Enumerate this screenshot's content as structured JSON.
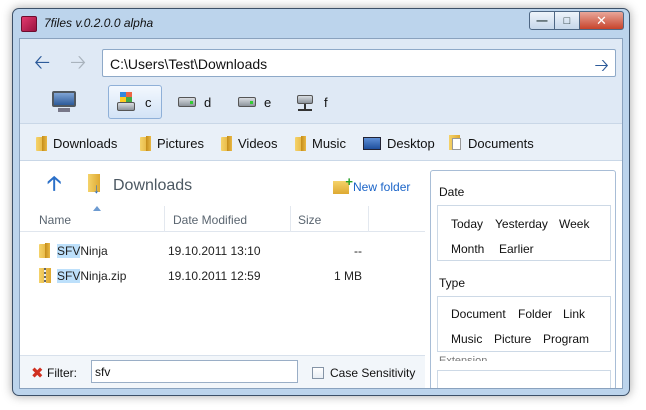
{
  "window": {
    "title": "7files v.0.2.0.0 alpha"
  },
  "address": {
    "path": "C:\\Users\\Test\\Downloads"
  },
  "drives": [
    {
      "label": "c",
      "icon": "windows-drive-icon",
      "selected": true
    },
    {
      "label": "d",
      "icon": "hard-drive-icon"
    },
    {
      "label": "e",
      "icon": "hard-drive-icon"
    },
    {
      "label": "f",
      "icon": "network-drive-icon"
    }
  ],
  "favorites": [
    {
      "label": "Downloads",
      "icon": "folder-icon"
    },
    {
      "label": "Pictures",
      "icon": "folder-icon"
    },
    {
      "label": "Videos",
      "icon": "folder-icon"
    },
    {
      "label": "Music",
      "icon": "folder-icon"
    },
    {
      "label": "Desktop",
      "icon": "desktop-icon"
    },
    {
      "label": "Documents",
      "icon": "documents-icon"
    }
  ],
  "panel": {
    "current_folder": "Downloads",
    "new_folder_label": "New folder",
    "columns": [
      "Name",
      "Date Modified",
      "Size"
    ],
    "files": [
      {
        "name_highlight": "SFV",
        "name_rest": "Ninja",
        "date": "19.10.2011 13:10",
        "size": "--",
        "icon": "folder-icon"
      },
      {
        "name_highlight": "SFV",
        "name_rest": "Ninja.zip",
        "date": "19.10.2011 12:59",
        "size": "1 MB",
        "icon": "zip-icon"
      }
    ]
  },
  "filter": {
    "label": "Filter:",
    "value": "sfv",
    "case_label": "Case Sensitivity",
    "case_checked": false
  },
  "facets": {
    "date": {
      "title": "Date",
      "items": [
        "Today",
        "Yesterday",
        "Week",
        "Month",
        "Earlier"
      ]
    },
    "type": {
      "title": "Type",
      "items": [
        "Document",
        "Folder",
        "Link",
        "Music",
        "Picture",
        "Program"
      ]
    },
    "extension": {
      "title": "Extension"
    }
  }
}
